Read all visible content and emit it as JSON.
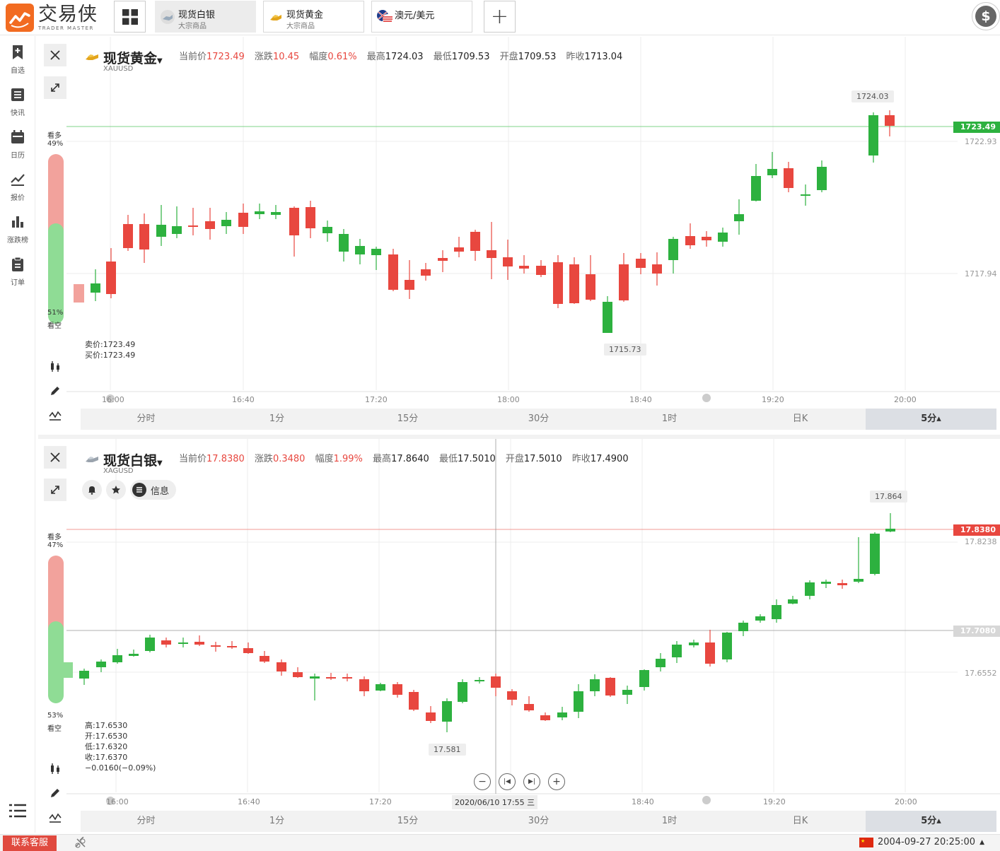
{
  "app": {
    "logo_cn": "交易侠",
    "logo_en": "TRADER MASTER"
  },
  "tabs": [
    {
      "name": "现货白银",
      "sub": "大宗商品",
      "active": true
    },
    {
      "name": "现货黄金",
      "sub": "大宗商品",
      "active": false
    },
    {
      "name": "澳元/美元",
      "sub": "",
      "active": false
    }
  ],
  "sidebar": [
    {
      "label": "自选",
      "icon": "bookmark-add-icon"
    },
    {
      "label": "快讯",
      "icon": "news-list-icon"
    },
    {
      "label": "日历",
      "icon": "calendar-icon"
    },
    {
      "label": "报价",
      "icon": "line-chart-icon"
    },
    {
      "label": "涨跌榜",
      "icon": "bar-chart-icon"
    },
    {
      "label": "订单",
      "icon": "clipboard-icon"
    }
  ],
  "periods": [
    "分时",
    "1分",
    "15分",
    "30分",
    "1时",
    "日K",
    "5分▴"
  ],
  "time_labels": [
    "16:00",
    "16:40",
    "17:20",
    "18:00",
    "18:40",
    "19:20",
    "20:00"
  ],
  "gold": {
    "title": "现货黄金",
    "code": "XAUUSD",
    "quote": {
      "cur_label": "当前价",
      "cur": "1723.49",
      "chg_label": "涨跌",
      "chg": "10.45",
      "pct_label": "幅度",
      "pct": "0.61%",
      "high_label": "最高",
      "high": "1724.03",
      "low_label": "最低",
      "low": "1709.53",
      "open_label": "开盘",
      "open": "1709.53",
      "prev_label": "昨收",
      "prev": "1713.04"
    },
    "bull_label": "看多",
    "bull_pct": "49%",
    "bear_label": "看空",
    "bear_pct": "51%",
    "bull_value": 49,
    "bid_ask": "卖价:1723.49\n买价:1723.49",
    "price_tag": "1723.49",
    "axis": [
      "1722.93",
      "1717.94"
    ],
    "hi_callout": "1724.03",
    "lo_callout": "1715.73"
  },
  "silver": {
    "title": "现货白银",
    "code": "XAGUSD",
    "quote": {
      "cur_label": "当前价",
      "cur": "17.8380",
      "chg_label": "涨跌",
      "chg": "0.3480",
      "pct_label": "幅度",
      "pct": "1.99%",
      "high_label": "最高",
      "high": "17.8640",
      "low_label": "最低",
      "low": "17.5010",
      "open_label": "开盘",
      "open": "17.5010",
      "prev_label": "昨收",
      "prev": "17.4900"
    },
    "info_label": "信息",
    "bull_label": "看多",
    "bull_pct": "47%",
    "bear_label": "看空",
    "bear_pct": "53%",
    "bull_value": 47,
    "ohlc": "高:17.6530\n开:17.6530\n低:17.6320\n收:17.6370\n−0.0160(−0.09%)",
    "price_tag": "17.8380",
    "cross_tag": "17.7080",
    "axis": [
      "17.8238",
      "17.6552"
    ],
    "hi_callout": "17.864",
    "lo_callout": "17.581",
    "crosshair_date": "2020/06/10 17:55 三"
  },
  "footer": {
    "contact": "联系客服",
    "datetime": "2004-09-27 20:25:00"
  },
  "colors": {
    "up": "#e8473f",
    "down": "#2db13f",
    "accent": "#f26b21"
  }
}
